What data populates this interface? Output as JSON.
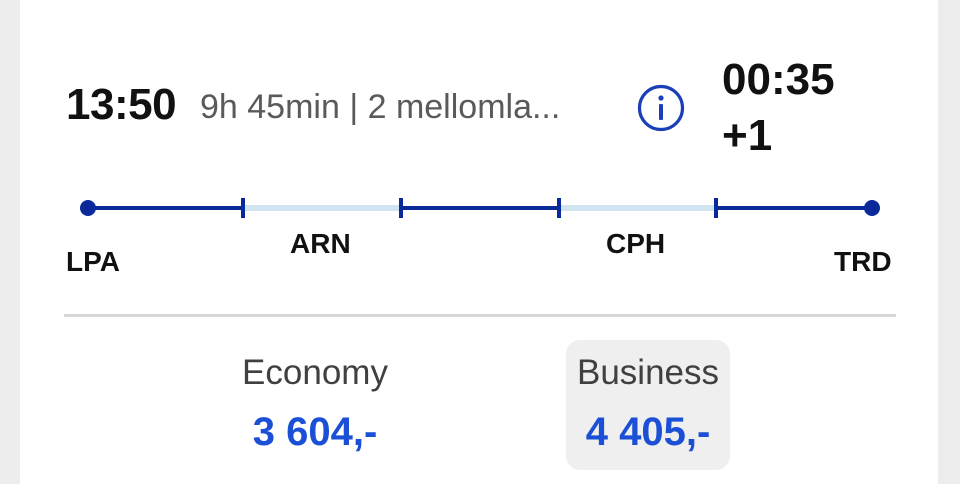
{
  "flight": {
    "departure_time": "13:50",
    "summary": "9h 45min | 2 mellomla...",
    "arrival_time": "00:35",
    "arrival_day_offset": "+1",
    "info_icon": "info-circle-icon"
  },
  "route": {
    "origin": "LPA",
    "stops": [
      "ARN",
      "CPH"
    ],
    "destination": "TRD",
    "colors": {
      "flight_segment": "#0b2a99",
      "layover_segment": "#cfe4f0"
    }
  },
  "fares": [
    {
      "class": "Economy",
      "price": "3 604,-",
      "selected": false
    },
    {
      "class": "Business",
      "price": "4 405,-",
      "selected": true
    }
  ],
  "colors": {
    "price": "#1a4fd6",
    "info_icon": "#1a3fb8",
    "divider": "#d6d6d6"
  }
}
